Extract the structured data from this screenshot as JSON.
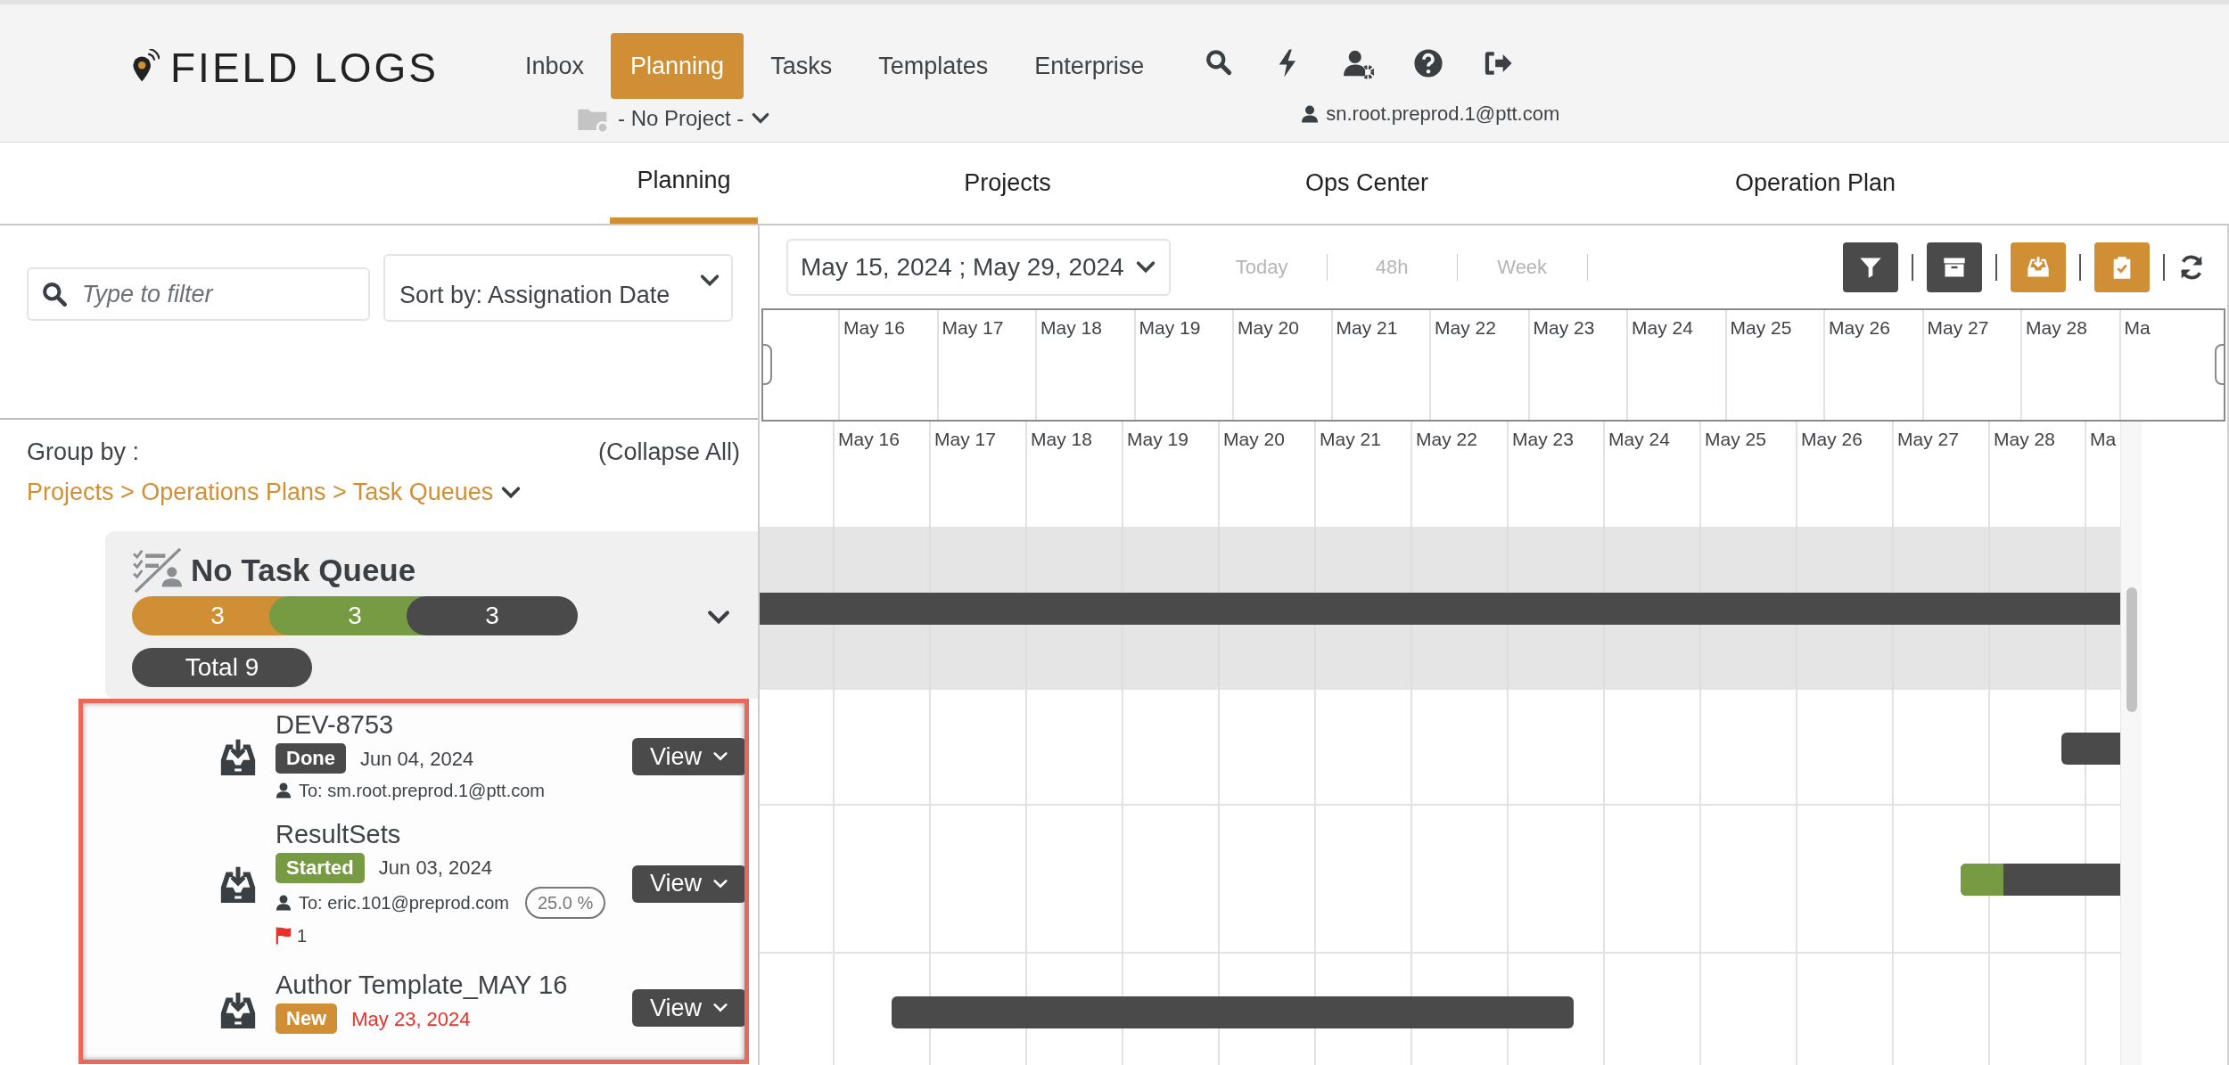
{
  "header": {
    "logo": "FIELD LOGS",
    "nav": [
      {
        "label": "Inbox",
        "selected": false
      },
      {
        "label": "Planning",
        "selected": true
      },
      {
        "label": "Tasks",
        "selected": false
      },
      {
        "label": "Templates",
        "selected": false
      },
      {
        "label": "Enterprise",
        "selected": false
      }
    ],
    "project": "- No Project -",
    "user": "sn.root.preprod.1@ptt.com"
  },
  "tabs": [
    {
      "label": "Planning",
      "selected": true
    },
    {
      "label": "Projects",
      "selected": false
    },
    {
      "label": "Ops Center",
      "selected": false
    },
    {
      "label": "Operation Plan",
      "selected": false
    }
  ],
  "filter": {
    "placeholder": "Type to filter"
  },
  "sort": "Sort by: Assignation Date",
  "group_by": {
    "label": "Group by :",
    "value": "Projects > Operations Plans > Task Queues",
    "collapse": "(Collapse All)"
  },
  "queue": {
    "title": "No Task Queue",
    "expanded": true,
    "total": "Total 9",
    "counts": [
      {
        "value": "3",
        "color": "#d18f35"
      },
      {
        "value": "3",
        "color": "#769b42"
      },
      {
        "value": "3",
        "color": "#4a4a4a"
      }
    ]
  },
  "tasks": [
    {
      "name": "DEV-8753",
      "kind": "done",
      "status": "Done",
      "date": "Jun 04, 2024",
      "overdue": false,
      "assignee": "To: sm.root.preprod.1@ptt.com",
      "button": "View"
    },
    {
      "name": "ResultSets",
      "kind": "started",
      "status": "Started",
      "date": "Jun 03, 2024",
      "overdue": false,
      "assignee": "To: eric.101@preprod.com",
      "progress": "25.0 %",
      "flags": "1",
      "level": 0.25,
      "button": "View"
    },
    {
      "name": "Author Template_MAY 16",
      "kind": "new",
      "status": "New",
      "date": "May 23, 2024",
      "overdue": true,
      "button": "View"
    }
  ],
  "gantt": {
    "range": "May 15, 2024 ; May 29, 2024",
    "views": [
      "Today",
      "48h",
      "Week"
    ],
    "toolbar": [
      {
        "kind": "filter",
        "selected": false
      },
      {
        "kind": "archive",
        "selected": false
      },
      {
        "kind": "inbox",
        "selected": true
      },
      {
        "kind": "clipboard",
        "selected": true
      }
    ],
    "days_top": [
      "May 16",
      "May 17",
      "May 18",
      "May 19",
      "May 20",
      "May 21",
      "May 22",
      "May 23",
      "May 24",
      "May 25",
      "May 26",
      "May 27",
      "May 28",
      "Ma"
    ],
    "days": [
      "May 16",
      "May 17",
      "May 18",
      "May 19",
      "May 20",
      "May 21",
      "May 22",
      "May 23",
      "May 24",
      "May 25",
      "May 26",
      "May 27",
      "May 28",
      "Ma"
    ]
  }
}
